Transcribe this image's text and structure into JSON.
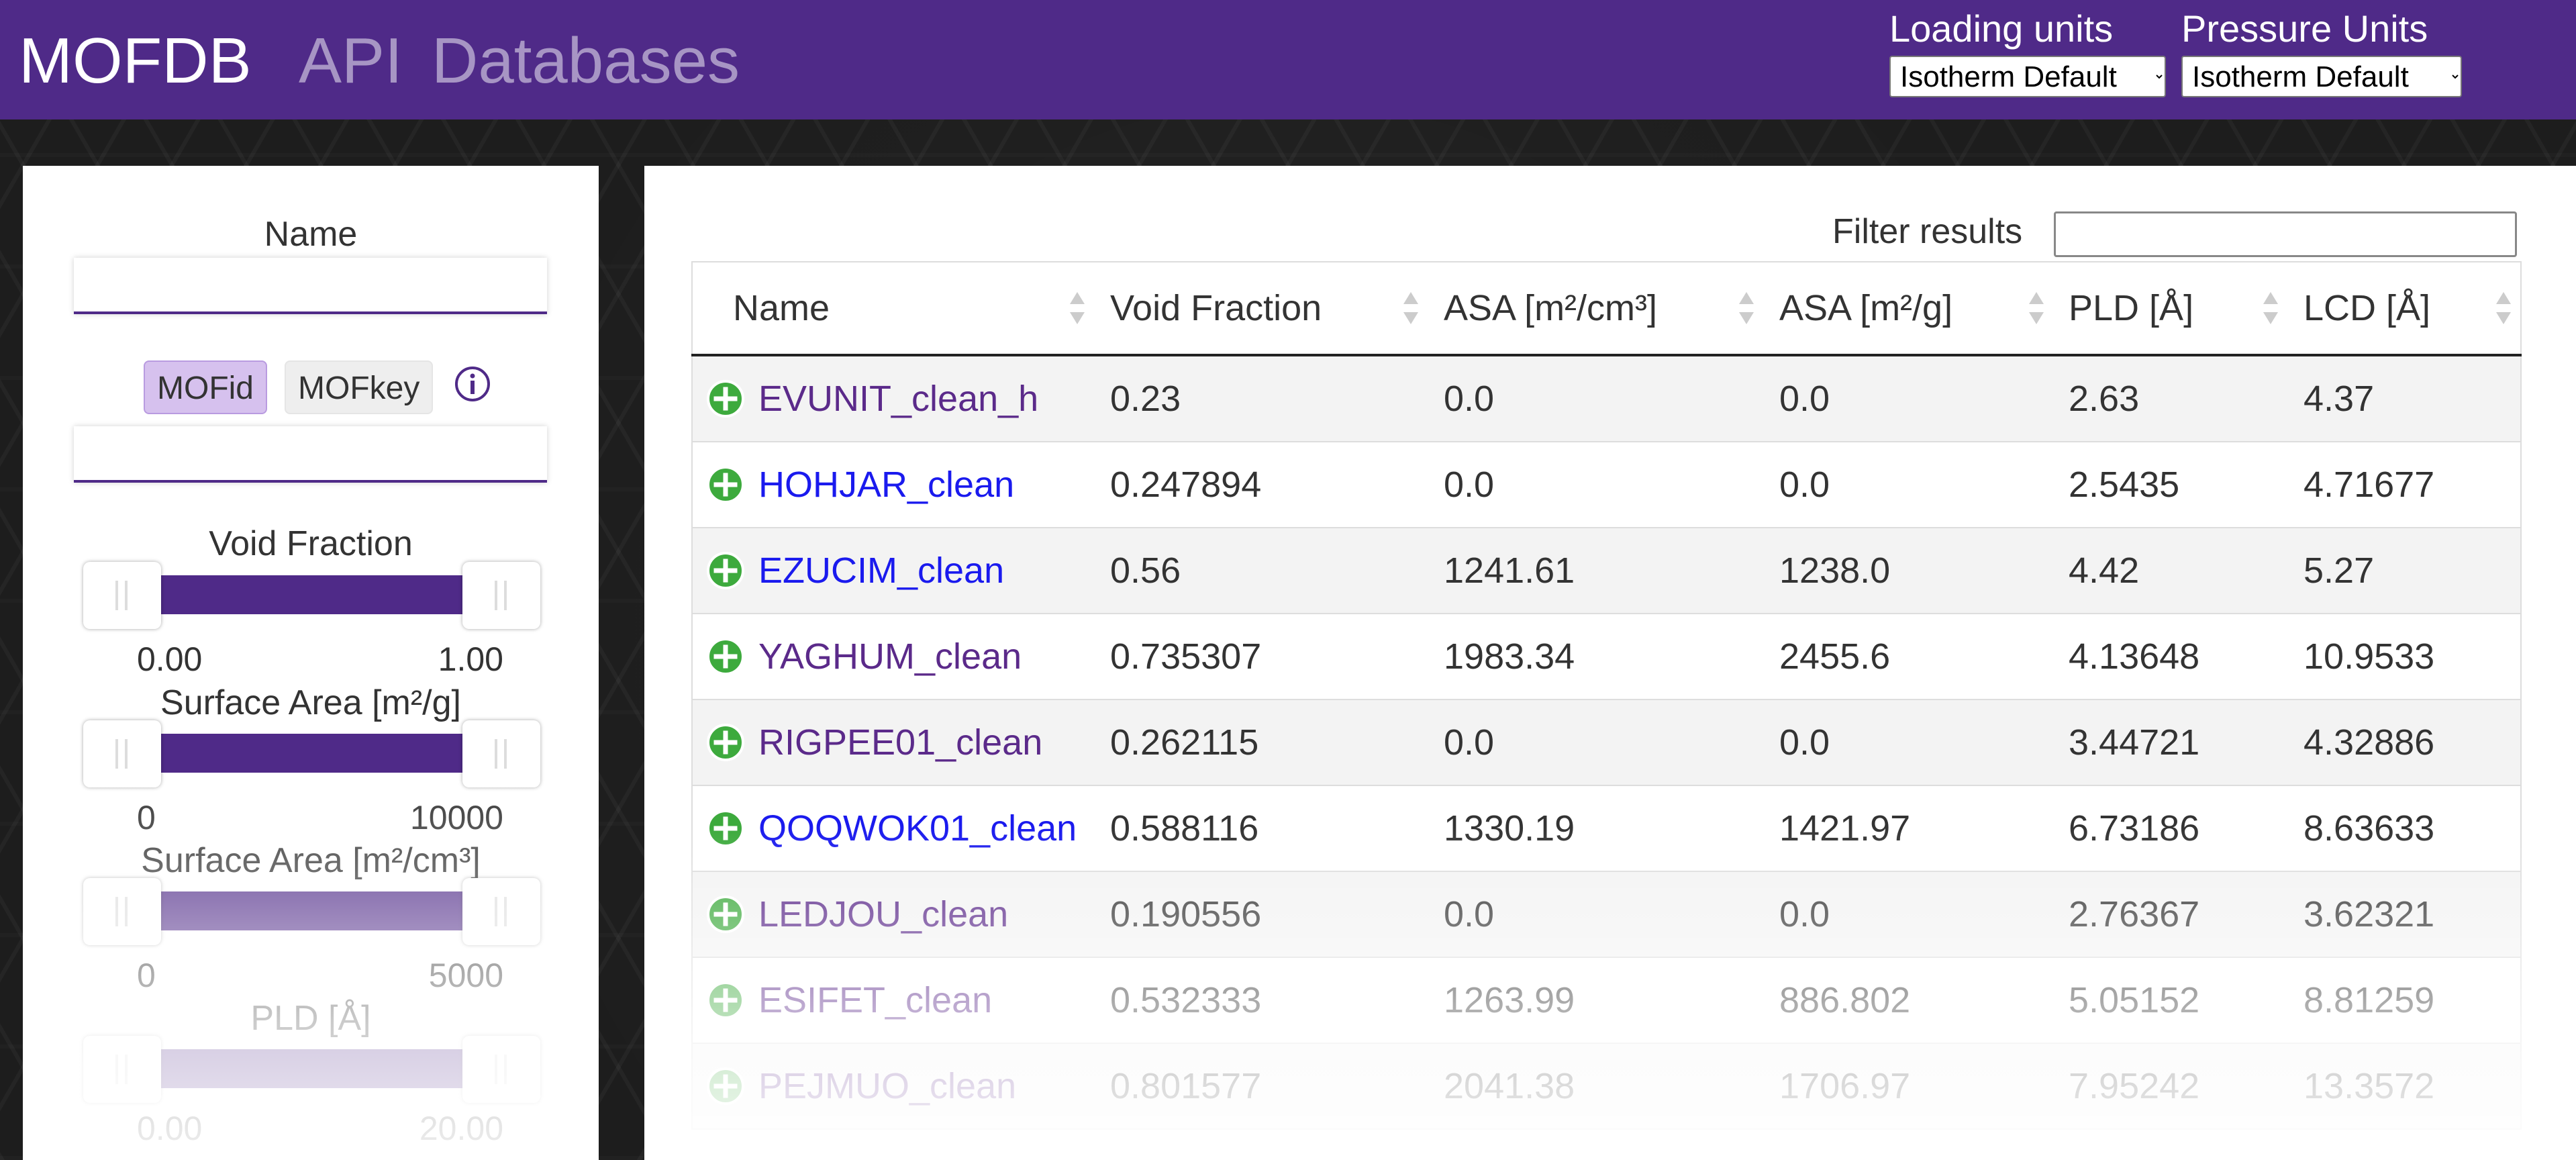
{
  "navbar": {
    "brand": "MOFDB",
    "links": [
      "API",
      "Databases"
    ],
    "loading_units": {
      "label": "Loading units",
      "selected": "Isotherm Default"
    },
    "pressure_units": {
      "label": "Pressure Units",
      "selected": "Isotherm Default"
    }
  },
  "sidebar": {
    "name_label": "Name",
    "mofid_label": "MOFid",
    "mofkey_label": "MOFkey",
    "sliders": [
      {
        "label": "Void Fraction",
        "min": "0.00",
        "max": "1.00"
      },
      {
        "label": "Surface Area [m²/g]",
        "min": "0",
        "max": "10000"
      },
      {
        "label": "Surface Area [m²/cm³]",
        "min": "0",
        "max": "5000"
      },
      {
        "label": "PLD [Å]",
        "min": "0.00",
        "max": "20.00"
      }
    ]
  },
  "main": {
    "filter_label": "Filter results",
    "columns": [
      "Name",
      "Void Fraction",
      "ASA [m²/cm³]",
      "ASA [m²/g]",
      "PLD [Å]",
      "LCD [Å]"
    ],
    "rows": [
      {
        "name": "EVUNIT_clean_h",
        "values": [
          "0.23",
          "0.0",
          "0.0",
          "2.63",
          "4.37"
        ]
      },
      {
        "name": "HOHJAR_clean",
        "values": [
          "0.247894",
          "0.0",
          "0.0",
          "2.5435",
          "4.71677"
        ]
      },
      {
        "name": "EZUCIM_clean",
        "values": [
          "0.56",
          "1241.61",
          "1238.0",
          "4.42",
          "5.27"
        ]
      },
      {
        "name": "YAGHUM_clean",
        "values": [
          "0.735307",
          "1983.34",
          "2455.6",
          "4.13648",
          "10.9533"
        ]
      },
      {
        "name": "RIGPEE01_clean",
        "values": [
          "0.262115",
          "0.0",
          "0.0",
          "3.44721",
          "4.32886"
        ]
      },
      {
        "name": "QOQWOK01_clean",
        "values": [
          "0.588116",
          "1330.19",
          "1421.97",
          "6.73186",
          "8.63633"
        ]
      },
      {
        "name": "LEDJOU_clean",
        "values": [
          "0.190556",
          "0.0",
          "0.0",
          "2.76367",
          "3.62321"
        ]
      },
      {
        "name": "ESIFET_clean",
        "values": [
          "0.532333",
          "1263.99",
          "886.802",
          "5.05152",
          "8.81259"
        ]
      },
      {
        "name": "PEJMUO_clean",
        "values": [
          "0.801577",
          "2041.38",
          "1706.97",
          "7.95242",
          "13.3572"
        ]
      }
    ]
  },
  "colors": {
    "navbar": "#4f2a88",
    "slider_fill": "#4f2a88",
    "link_visited": "#5b2a8a",
    "link_unvisited": "#1a1aee",
    "add_icon": "#3daa3d"
  }
}
